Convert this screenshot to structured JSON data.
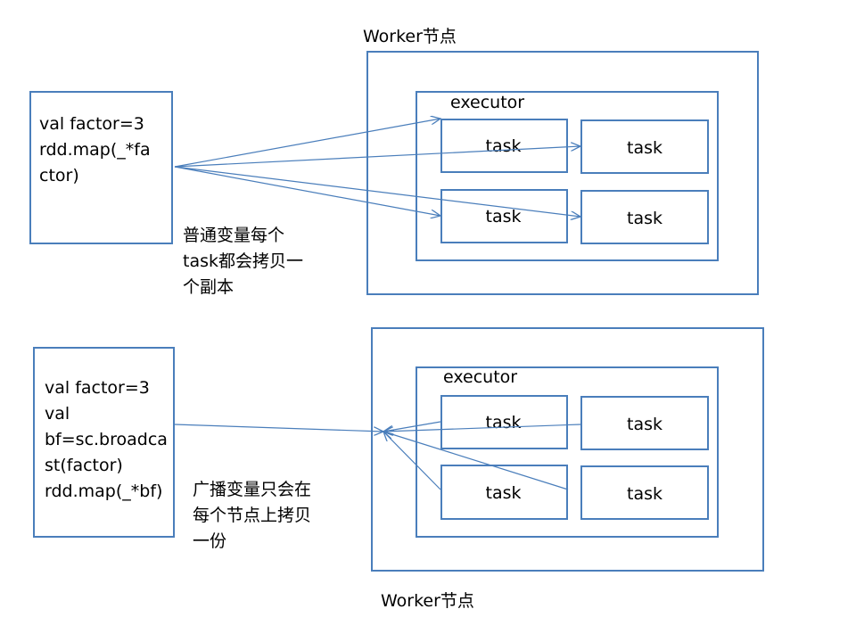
{
  "top": {
    "worker_label": "Worker节点",
    "executor_label": "executor",
    "code_lines": [
      "val factor=3",
      "rdd.map(_*fa",
      "ctor)"
    ],
    "tasks": [
      "task",
      "task",
      "task",
      "task"
    ],
    "note_lines": [
      "普通变量每个",
      "task都会拷贝一",
      "个副本"
    ]
  },
  "bottom": {
    "worker_label": "Worker节点",
    "executor_label": "executor",
    "code_lines": [
      "val factor=3",
      "val",
      "bf=sc.broadca",
      "st(factor)",
      "rdd.map(_*bf)"
    ],
    "tasks": [
      "task",
      "task",
      "task",
      "task"
    ],
    "note_lines": [
      "广播变量只会在",
      "每个节点上拷贝",
      "一份"
    ]
  },
  "colors": {
    "border": "#4a7ebb",
    "arrow": "#4a7ebb"
  }
}
